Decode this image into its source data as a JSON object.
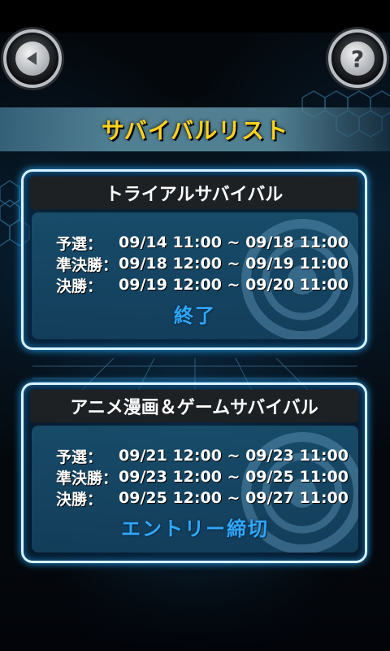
{
  "header": {
    "back_icon": "back-triangle-icon",
    "help_icon": "question-mark-icon",
    "help_glyph": "?"
  },
  "title": "サバイバルリスト",
  "colors": {
    "title": "#ffd21a",
    "status": "#2fa8ff",
    "card_border": "#d9f3ff",
    "card_glow": "#21a8ff"
  },
  "cards": [
    {
      "heading": "トライアルサバイバル",
      "rows": [
        {
          "label": "予選：",
          "time": "09/14 11:00 ~ 09/18 11:00"
        },
        {
          "label": "準決勝：",
          "time": "09/18 12:00 ~ 09/19 11:00"
        },
        {
          "label": "決勝：",
          "time": "09/19 12:00 ~ 09/20 11:00"
        }
      ],
      "status": "終了"
    },
    {
      "heading": "アニメ漫画＆ゲームサバイバル",
      "rows": [
        {
          "label": "予選：",
          "time": "09/21 12:00 ~ 09/23 11:00"
        },
        {
          "label": "準決勝：",
          "time": "09/23 12:00 ~ 09/25 11:00"
        },
        {
          "label": "決勝：",
          "time": "09/25 12:00 ~ 09/27 11:00"
        }
      ],
      "status": "エントリー締切"
    }
  ]
}
